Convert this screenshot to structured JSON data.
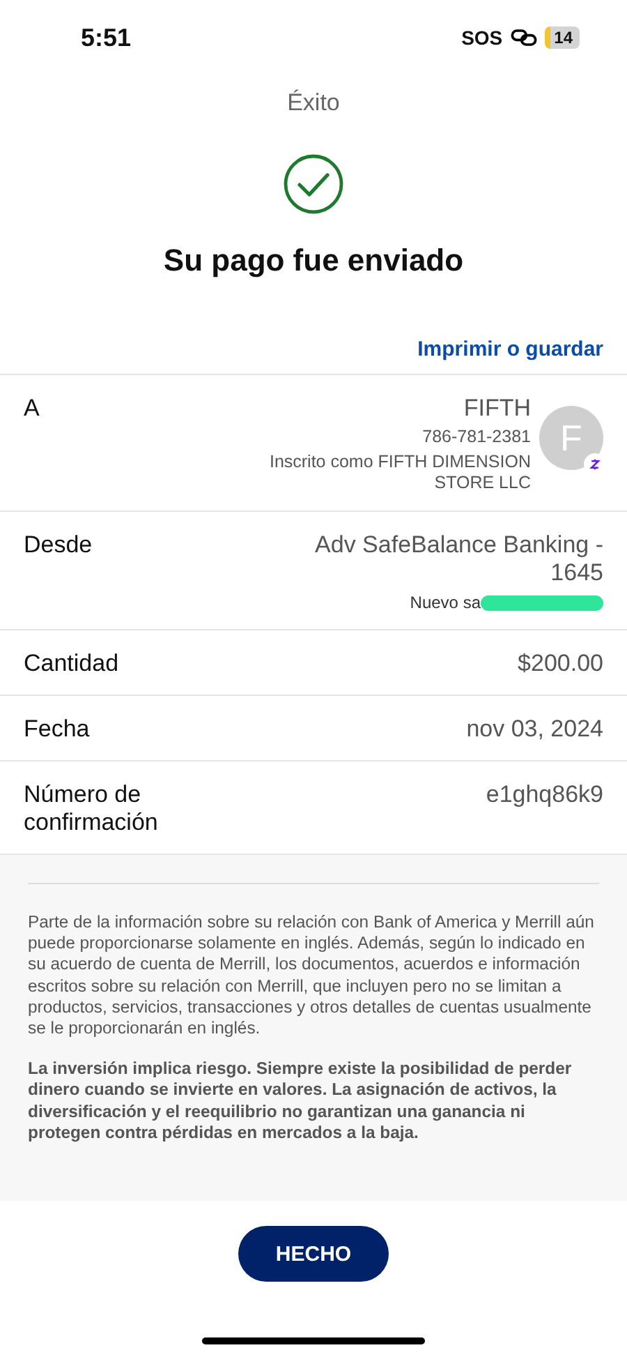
{
  "status_bar": {
    "time": "5:51",
    "carrier": "SOS",
    "battery": "14"
  },
  "header": {
    "title": "Éxito"
  },
  "result": {
    "heading": "Su pago fue enviado"
  },
  "actions": {
    "print_link": "Imprimir o guardar"
  },
  "details": [
    {
      "kind": "recipient",
      "label": "A",
      "name": "FIFTH",
      "phone": "786-781-2381",
      "enrolled": "Inscrito como FIFTH DIMENSION STORE LLC",
      "avatar": "F"
    },
    {
      "kind": "account",
      "label": "Desde",
      "value": "Adv SafeBalance Banking - 1645",
      "note": "Nuevo sa"
    },
    {
      "kind": "plain",
      "label": "Cantidad",
      "value": "$200.00"
    },
    {
      "kind": "plain",
      "label": "Fecha",
      "value": "nov 03, 2024"
    },
    {
      "kind": "plain",
      "label": "Número de confirmación",
      "value": "e1ghq86k9"
    }
  ],
  "disclosures": [
    {
      "emphasis": false,
      "text": "Parte de la información sobre su relación con Bank of America y Merrill aún puede proporcionarse solamente en inglés. Además, según lo indicado en su acuerdo de cuenta de Merrill, los documentos, acuerdos e información escritos sobre su relación con Merrill, que incluyen pero no se limitan a productos, servicios, transacciones y otros detalles de cuentas usualmente se le proporcionarán en inglés."
    },
    {
      "emphasis": true,
      "text": "La inversión implica riesgo. Siempre existe la posibilidad de perder dinero cuando se invierte en valores. La asignación de activos, la diversificación y el reequilibrio no garantizan una ganancia ni protegen contra pérdidas en mercados a la baja."
    }
  ],
  "footer": {
    "button": "HECHO"
  }
}
